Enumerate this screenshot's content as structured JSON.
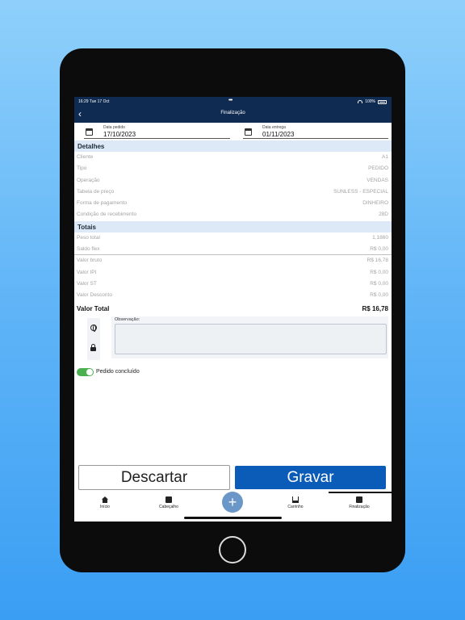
{
  "status": {
    "time": "16:29",
    "date": "Tue 17 Oct",
    "dots": "•••",
    "battery": "100%"
  },
  "header": {
    "back_icon": "‹",
    "title": "Finalização"
  },
  "dates": {
    "pedido": {
      "label": "Data pedido",
      "value": "17/10/2023"
    },
    "entrega": {
      "label": "Data entrega",
      "value": "01/11/2023"
    }
  },
  "detalhes": {
    "title": "Detalhes",
    "rows": [
      {
        "label": "Cliente",
        "value": "A1"
      },
      {
        "label": "Tipo",
        "value": "PEDIDO"
      },
      {
        "label": "Operação",
        "value": "VENDAS"
      },
      {
        "label": "Tabela de preço",
        "value": "SUNLESS - ESPECIAL"
      },
      {
        "label": "Forma de pagamento",
        "value": "DINHEIRO"
      },
      {
        "label": "Condição de recebimento",
        "value": "28D"
      }
    ]
  },
  "totais": {
    "title": "Totais",
    "rows": [
      {
        "label": "Peso total",
        "value": "1,1860"
      },
      {
        "label": "Saldo flex",
        "value": "R$ 0,00"
      },
      {
        "label": "Valor bruto",
        "value": "R$ 16,78"
      },
      {
        "label": "Valor IPI",
        "value": "R$ 0,00"
      },
      {
        "label": "Valor ST",
        "value": "R$ 0,00"
      },
      {
        "label": "Valor Desconto",
        "value": "R$ 0,00"
      }
    ],
    "total_label": "Valor Total",
    "total_value": "R$ 16,78"
  },
  "observacao": {
    "label": "Observação:",
    "value": ""
  },
  "pedido_concluido": {
    "label": "Pedido concluído",
    "on": true
  },
  "buttons": {
    "discard": "Descartar",
    "save": "Gravar"
  },
  "bottom_nav": {
    "fab": "+",
    "items": [
      {
        "label": "Início",
        "icon": "home-icon"
      },
      {
        "label": "Cabeçalho",
        "icon": "clipboard-icon"
      },
      {
        "label": "Carrinho",
        "icon": "cart-icon"
      },
      {
        "label": "Finalização",
        "icon": "document-icon",
        "active": true
      }
    ]
  },
  "colors": {
    "navbar": "#0f2b52",
    "section_header": "#dde9f6",
    "primary_button": "#0b5bb8",
    "toggle_on": "#4caf50",
    "fab": "#6b96c8"
  }
}
